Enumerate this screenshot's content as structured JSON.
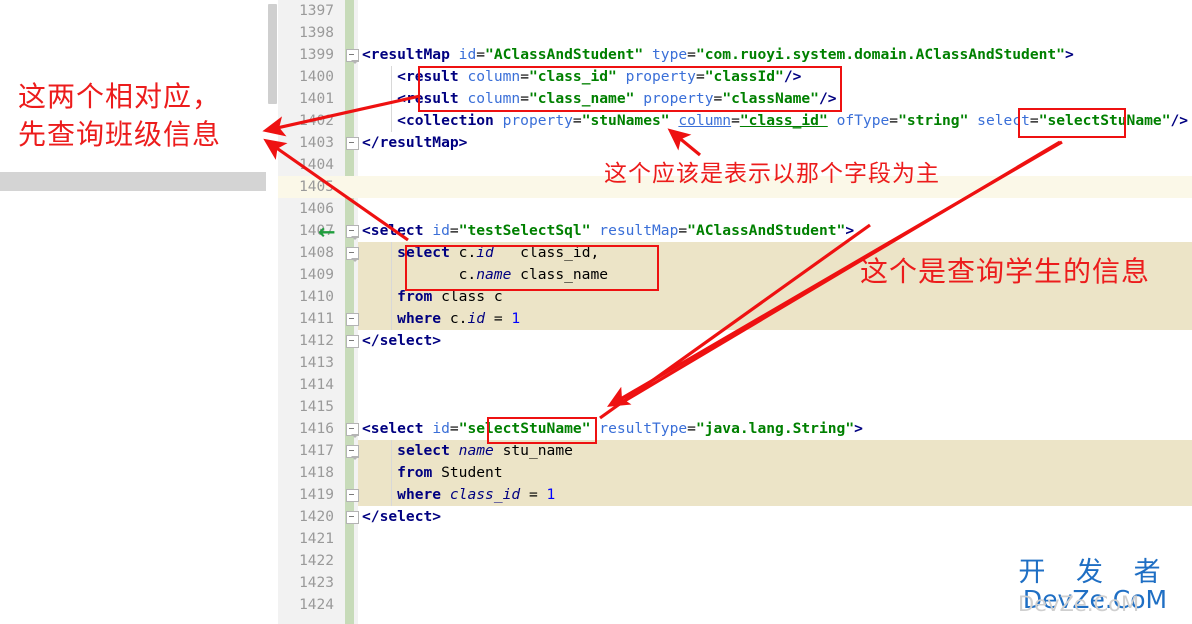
{
  "editor": {
    "first_line": 1397,
    "lines": [
      {
        "n": 1397,
        "text": "",
        "bg": "none"
      },
      {
        "n": 1398,
        "text": "",
        "bg": "none"
      },
      {
        "n": 1399,
        "text": "<resultMap id=\"AClassAndStudent\" type=\"com.ruoyi.system.domain.AClassAndStudent\">",
        "bg": "none"
      },
      {
        "n": 1400,
        "text": "    <result column=\"class_id\" property=\"classId\"/>",
        "bg": "none"
      },
      {
        "n": 1401,
        "text": "    <result column=\"class_name\" property=\"className\"/>",
        "bg": "none"
      },
      {
        "n": 1402,
        "text": "    <collection property=\"stuNames\" column=\"class_id\" ofType=\"string\" select=\"selectStuName\"/>",
        "bg": "none"
      },
      {
        "n": 1403,
        "text": "</resultMap>",
        "bg": "none"
      },
      {
        "n": 1404,
        "text": "",
        "bg": "none"
      },
      {
        "n": 1405,
        "text": "",
        "bg": "beige-light"
      },
      {
        "n": 1406,
        "text": "",
        "bg": "none"
      },
      {
        "n": 1407,
        "text": "<select id=\"testSelectSql\" resultMap=\"AClassAndStudent\">",
        "bg": "none"
      },
      {
        "n": 1408,
        "text": "    select c.id   class_id,",
        "bg": "beige"
      },
      {
        "n": 1409,
        "text": "           c.name class_name",
        "bg": "beige"
      },
      {
        "n": 1410,
        "text": "    from class c",
        "bg": "beige"
      },
      {
        "n": 1411,
        "text": "    where c.id = 1",
        "bg": "beige"
      },
      {
        "n": 1412,
        "text": "</select>",
        "bg": "none"
      },
      {
        "n": 1413,
        "text": "",
        "bg": "none"
      },
      {
        "n": 1414,
        "text": "",
        "bg": "none"
      },
      {
        "n": 1415,
        "text": "",
        "bg": "none"
      },
      {
        "n": 1416,
        "text": "<select id=\"selectStuName\" resultType=\"java.lang.String\">",
        "bg": "none"
      },
      {
        "n": 1417,
        "text": "    select name stu_name",
        "bg": "beige"
      },
      {
        "n": 1418,
        "text": "    from Student",
        "bg": "beige"
      },
      {
        "n": 1419,
        "text": "    where class_id = 1",
        "bg": "beige"
      },
      {
        "n": 1420,
        "text": "</select>",
        "bg": "none"
      },
      {
        "n": 1421,
        "text": "",
        "bg": "none"
      },
      {
        "n": 1422,
        "text": "",
        "bg": "none"
      },
      {
        "n": 1423,
        "text": "",
        "bg": "none"
      },
      {
        "n": 1424,
        "text": "",
        "bg": "none"
      }
    ]
  },
  "code_tokens": {
    "l1399": [
      {
        "t": "<resultMap",
        "c": "tag"
      },
      {
        "t": " ",
        "c": "plain"
      },
      {
        "t": "id",
        "c": "attr"
      },
      {
        "t": "=",
        "c": "plain"
      },
      {
        "t": "\"AClassAndStudent\"",
        "c": "str"
      },
      {
        "t": " ",
        "c": "plain"
      },
      {
        "t": "type",
        "c": "attr"
      },
      {
        "t": "=",
        "c": "plain"
      },
      {
        "t": "\"com.ruoyi.system.domain.AClassAndStudent\"",
        "c": "str"
      },
      {
        "t": ">",
        "c": "tag"
      }
    ],
    "l1400": [
      {
        "t": "    ",
        "c": "plain"
      },
      {
        "t": "<result",
        "c": "tag"
      },
      {
        "t": " ",
        "c": "plain"
      },
      {
        "t": "column",
        "c": "attr"
      },
      {
        "t": "=",
        "c": "plain"
      },
      {
        "t": "\"class_id\"",
        "c": "str"
      },
      {
        "t": " ",
        "c": "plain"
      },
      {
        "t": "property",
        "c": "attr"
      },
      {
        "t": "=",
        "c": "plain"
      },
      {
        "t": "\"classId\"",
        "c": "str"
      },
      {
        "t": "/>",
        "c": "tag"
      }
    ],
    "l1401": [
      {
        "t": "    ",
        "c": "plain"
      },
      {
        "t": "<result",
        "c": "tag"
      },
      {
        "t": " ",
        "c": "plain"
      },
      {
        "t": "column",
        "c": "attr"
      },
      {
        "t": "=",
        "c": "plain"
      },
      {
        "t": "\"class_name\"",
        "c": "str"
      },
      {
        "t": " ",
        "c": "plain"
      },
      {
        "t": "property",
        "c": "attr"
      },
      {
        "t": "=",
        "c": "plain"
      },
      {
        "t": "\"className\"",
        "c": "str"
      },
      {
        "t": "/>",
        "c": "tag"
      }
    ],
    "l1402": [
      {
        "t": "    ",
        "c": "plain"
      },
      {
        "t": "<collection",
        "c": "tag"
      },
      {
        "t": " ",
        "c": "plain"
      },
      {
        "t": "property",
        "c": "attr"
      },
      {
        "t": "=",
        "c": "plain"
      },
      {
        "t": "\"stuNames\"",
        "c": "str"
      },
      {
        "t": " ",
        "c": "plain"
      },
      {
        "t": "column",
        "c": "attr-und"
      },
      {
        "t": "=",
        "c": "plain"
      },
      {
        "t": "\"class_id\"",
        "c": "str-und"
      },
      {
        "t": " ",
        "c": "plain"
      },
      {
        "t": "ofType",
        "c": "attr"
      },
      {
        "t": "=",
        "c": "plain"
      },
      {
        "t": "\"string\"",
        "c": "str"
      },
      {
        "t": " ",
        "c": "plain"
      },
      {
        "t": "select",
        "c": "attr"
      },
      {
        "t": "=",
        "c": "plain"
      },
      {
        "t": "\"selectStuName\"",
        "c": "str"
      },
      {
        "t": "/>",
        "c": "tag"
      }
    ],
    "l1403": [
      {
        "t": "</resultMap>",
        "c": "tag"
      }
    ],
    "l1407": [
      {
        "t": "<select",
        "c": "tag"
      },
      {
        "t": " ",
        "c": "plain"
      },
      {
        "t": "id",
        "c": "attr"
      },
      {
        "t": "=",
        "c": "plain"
      },
      {
        "t": "\"testSelectSql\"",
        "c": "str"
      },
      {
        "t": " ",
        "c": "plain"
      },
      {
        "t": "resultMap",
        "c": "attr"
      },
      {
        "t": "=",
        "c": "plain"
      },
      {
        "t": "\"AClassAndStudent\"",
        "c": "str"
      },
      {
        "t": ">",
        "c": "tag"
      }
    ],
    "l1408": [
      {
        "t": "    ",
        "c": "plain"
      },
      {
        "t": "select",
        "c": "kw"
      },
      {
        "t": " ",
        "c": "plain"
      },
      {
        "t": "c.",
        "c": "plain"
      },
      {
        "t": "id",
        "c": "sqlfield"
      },
      {
        "t": "   class_id,",
        "c": "plain"
      }
    ],
    "l1409": [
      {
        "t": "           c.",
        "c": "plain"
      },
      {
        "t": "name",
        "c": "sqlfield"
      },
      {
        "t": " class_name",
        "c": "plain"
      }
    ],
    "l1410": [
      {
        "t": "    ",
        "c": "plain"
      },
      {
        "t": "from",
        "c": "kw"
      },
      {
        "t": " class c",
        "c": "plain"
      }
    ],
    "l1411": [
      {
        "t": "    ",
        "c": "plain"
      },
      {
        "t": "where",
        "c": "kw"
      },
      {
        "t": " c.",
        "c": "plain"
      },
      {
        "t": "id",
        "c": "sqlfield"
      },
      {
        "t": " = ",
        "c": "plain"
      },
      {
        "t": "1",
        "c": "num"
      }
    ],
    "l1412": [
      {
        "t": "</select>",
        "c": "tag"
      }
    ],
    "l1416": [
      {
        "t": "<select",
        "c": "tag"
      },
      {
        "t": " ",
        "c": "plain"
      },
      {
        "t": "id",
        "c": "attr"
      },
      {
        "t": "=",
        "c": "plain"
      },
      {
        "t": "\"selectStuName\"",
        "c": "str"
      },
      {
        "t": " ",
        "c": "plain"
      },
      {
        "t": "resultType",
        "c": "attr"
      },
      {
        "t": "=",
        "c": "plain"
      },
      {
        "t": "\"java.lang.String\"",
        "c": "str"
      },
      {
        "t": ">",
        "c": "tag"
      }
    ],
    "l1417": [
      {
        "t": "    ",
        "c": "plain"
      },
      {
        "t": "select",
        "c": "kw"
      },
      {
        "t": " ",
        "c": "plain"
      },
      {
        "t": "name",
        "c": "sqlfield"
      },
      {
        "t": " stu_name",
        "c": "plain"
      }
    ],
    "l1418": [
      {
        "t": "    ",
        "c": "plain"
      },
      {
        "t": "from",
        "c": "kw"
      },
      {
        "t": " Student",
        "c": "plain"
      }
    ],
    "l1419": [
      {
        "t": "    ",
        "c": "plain"
      },
      {
        "t": "where",
        "c": "kw"
      },
      {
        "t": " ",
        "c": "plain"
      },
      {
        "t": "class_id",
        "c": "sqlfield"
      },
      {
        "t": " = ",
        "c": "plain"
      },
      {
        "t": "1",
        "c": "num"
      }
    ],
    "l1420": [
      {
        "t": "</select>",
        "c": "tag"
      }
    ]
  },
  "annotations": {
    "left": "这两个相对应，\n先查询班级信息",
    "left_line1": "这两个相对应，",
    "left_line2": "先查询班级信息",
    "middle": "这个应该是表示以那个字段为主",
    "right": "这个是查询学生的信息"
  },
  "gutter_markers": {
    "green_arrow_line": 1407,
    "green_arrow_glyph": "←"
  },
  "watermark": {
    "cn": "开 发 者",
    "en": "DevZe.CoM",
    "ghost": "DevZe.CoM"
  },
  "colors": {
    "annotation_red": "#ec1c1c",
    "redbox_border": "#ee1111",
    "sql_block_bg": "#ece4c7",
    "highlight_line_bg": "#fbf8e8",
    "gutter_bg": "#f2f2f2",
    "vcs_strip": "#c7dbb9",
    "lineno": "#9a9a9a",
    "watermark_blue": "#1f6fc4",
    "green_arrow": "#1f9e3d"
  }
}
